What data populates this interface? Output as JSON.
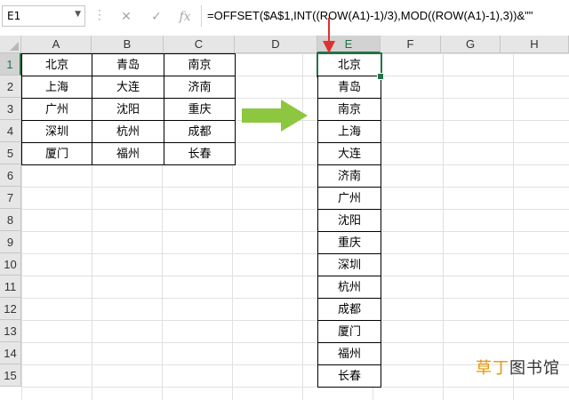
{
  "name_box": {
    "value": "E1"
  },
  "formula_bar": {
    "cancel_symbol": "✕",
    "confirm_symbol": "✓",
    "fx_symbol": "fx",
    "formula": "=OFFSET($A$1,INT((ROW(A1)-1)/3),MOD((ROW(A1)-1),3))&\"\""
  },
  "columns": [
    "A",
    "B",
    "C",
    "D",
    "E",
    "F",
    "G",
    "H"
  ],
  "rows": [
    "1",
    "2",
    "3",
    "4",
    "5",
    "6",
    "7",
    "8",
    "9",
    "10",
    "11",
    "12",
    "13",
    "14",
    "15"
  ],
  "source_table": [
    [
      "北京",
      "青岛",
      "南京"
    ],
    [
      "上海",
      "大连",
      "济南"
    ],
    [
      "广州",
      "沈阳",
      "重庆"
    ],
    [
      "深圳",
      "杭州",
      "成都"
    ],
    [
      "厦门",
      "福州",
      "长春"
    ]
  ],
  "result_column": [
    "北京",
    "青岛",
    "南京",
    "上海",
    "大连",
    "济南",
    "广州",
    "沈阳",
    "重庆",
    "深圳",
    "杭州",
    "成都",
    "厦门",
    "福州",
    "长春"
  ],
  "active_cell": "E1",
  "colors": {
    "selection": "#217346",
    "arrow_green": "#8dc63f",
    "pointer_red": "#e03030",
    "watermark_orange": "#e69500"
  },
  "watermark": {
    "part1": "草丁",
    "part2": "图书馆"
  }
}
